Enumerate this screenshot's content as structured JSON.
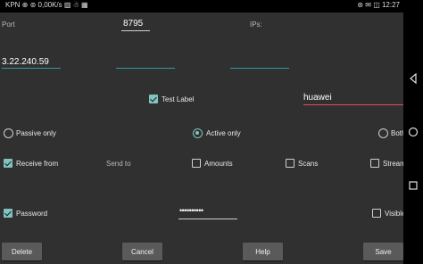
{
  "statusbar": {
    "left": "KPN  ⊕  ⊚  0,00K/s  ▨  ☃  ▦",
    "right": "⊛ ✉ ◫  12:27"
  },
  "row1": {
    "port_label": "Port",
    "port_value": "8795",
    "ips_label": "IPs:"
  },
  "row2": {
    "ip_value": "3.22.240.59"
  },
  "row3": {
    "test_label": "Test Label",
    "test_checked": true,
    "name_value": "huawei"
  },
  "row4": {
    "passive_label": "Passive only",
    "passive_selected": false,
    "active_label": "Active only",
    "active_selected": true,
    "both_label": "Both",
    "both_selected": false
  },
  "row5": {
    "receive_label": "Receive from",
    "receive_checked": true,
    "send_label": "Send to",
    "amounts_label": "Amounts",
    "amounts_checked": false,
    "scans_label": "Scans",
    "scans_checked": false,
    "stream_label": "Stream",
    "stream_checked": false
  },
  "row6": {
    "password_label": "Password",
    "password_checked": true,
    "password_value": "••••••••••",
    "visible_label": "Visible",
    "visible_checked": false
  },
  "buttons": {
    "delete": "Delete",
    "cancel": "Cancel",
    "help": "Help",
    "save": "Save"
  },
  "colors": {
    "accent": "#7fc4c0",
    "field_underline": "#2e9aa3",
    "error_underline": "#d9534f",
    "background": "#303030",
    "button": "#5a5a5a"
  }
}
